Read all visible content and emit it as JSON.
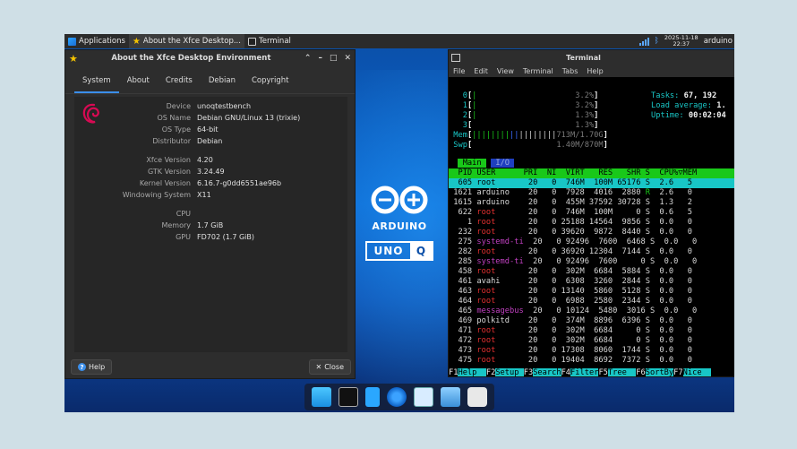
{
  "panel": {
    "apps_label": "Applications",
    "about_task": "About the Xfce Desktop...",
    "term_task": "Terminal",
    "date": "2025-11-18",
    "time": "22:37",
    "user": "arduino"
  },
  "about": {
    "title": "About the Xfce Desktop Environment",
    "tabs": [
      "System",
      "About",
      "Credits",
      "Debian",
      "Copyright"
    ],
    "rows": [
      {
        "k": "Device",
        "v": "unoqtestbench"
      },
      {
        "k": "OS Name",
        "v": "Debian GNU/Linux 13 (trixie)"
      },
      {
        "k": "OS Type",
        "v": "64-bit"
      },
      {
        "k": "Distributor",
        "v": "Debian"
      },
      {
        "k": "Xfce Version",
        "v": "4.20"
      },
      {
        "k": "GTK Version",
        "v": "3.24.49"
      },
      {
        "k": "Kernel Version",
        "v": "6.16.7-g0dd6551ae96b"
      },
      {
        "k": "Windowing System",
        "v": "X11"
      },
      {
        "k": "CPU",
        "v": ""
      },
      {
        "k": "Memory",
        "v": "1.7 GiB"
      },
      {
        "k": "GPU",
        "v": "FD702 (1.7 GiB)"
      }
    ],
    "help_label": "Help",
    "close_label": "Close"
  },
  "brand": {
    "word": "ARDUINO",
    "uno": "UNO",
    "q": "Q"
  },
  "terminal": {
    "title": "Terminal",
    "menu": [
      "File",
      "Edit",
      "View",
      "Terminal",
      "Tabs",
      "Help"
    ],
    "cpus": [
      {
        "n": "0",
        "pct": "3.2%"
      },
      {
        "n": "1",
        "pct": "3.2%"
      },
      {
        "n": "2",
        "pct": "1.3%"
      },
      {
        "n": "3",
        "pct": "1.3%"
      }
    ],
    "tasks_label": "Tasks:",
    "tasks_value": "67, 192",
    "load_label": "Load average:",
    "load_value": "1.",
    "uptime_label": "Uptime:",
    "uptime_value": "00:02:04",
    "mem_label": "Mem",
    "mem_value": "713M/1.70G",
    "swp_label": "Swp",
    "swp_value": "1.40M/870M",
    "tab_main": "Main",
    "tab_io": "I/O",
    "header": "  PID USER      PRI  NI  VIRT   RES   SHR S  CPU%▽MEM",
    "processes": [
      {
        "pid": "605",
        "user": "root",
        "pri": "20",
        "ni": "0",
        "virt": "746M",
        "res": "100M",
        "shr": "65176",
        "s": "S",
        "cpu": "2.6",
        "mem": "5"
      },
      {
        "pid": "1621",
        "user": "arduino",
        "pri": "20",
        "ni": "0",
        "virt": "7928",
        "res": "4016",
        "shr": "2880",
        "s": "R",
        "cpu": "2.6",
        "mem": "0"
      },
      {
        "pid": "1615",
        "user": "arduino",
        "pri": "20",
        "ni": "0",
        "virt": "455M",
        "res": "37592",
        "shr": "30728",
        "s": "S",
        "cpu": "1.3",
        "mem": "2"
      },
      {
        "pid": "622",
        "user": "root",
        "pri": "20",
        "ni": "0",
        "virt": "746M",
        "res": "100M",
        "shr": "0",
        "s": "S",
        "cpu": "0.6",
        "mem": "5"
      },
      {
        "pid": "1",
        "user": "root",
        "pri": "20",
        "ni": "0",
        "virt": "25188",
        "res": "14564",
        "shr": "9856",
        "s": "S",
        "cpu": "0.0",
        "mem": "0"
      },
      {
        "pid": "232",
        "user": "root",
        "pri": "20",
        "ni": "0",
        "virt": "39620",
        "res": "9872",
        "shr": "8440",
        "s": "S",
        "cpu": "0.0",
        "mem": "0"
      },
      {
        "pid": "275",
        "user": "systemd-ti",
        "pri": "20",
        "ni": "0",
        "virt": "92496",
        "res": "7600",
        "shr": "6468",
        "s": "S",
        "cpu": "0.0",
        "mem": "0"
      },
      {
        "pid": "282",
        "user": "root",
        "pri": "20",
        "ni": "0",
        "virt": "36920",
        "res": "12304",
        "shr": "7144",
        "s": "S",
        "cpu": "0.0",
        "mem": "0"
      },
      {
        "pid": "285",
        "user": "systemd-ti",
        "pri": "20",
        "ni": "0",
        "virt": "92496",
        "res": "7600",
        "shr": "0",
        "s": "S",
        "cpu": "0.0",
        "mem": "0"
      },
      {
        "pid": "458",
        "user": "root",
        "pri": "20",
        "ni": "0",
        "virt": "302M",
        "res": "6684",
        "shr": "5884",
        "s": "S",
        "cpu": "0.0",
        "mem": "0"
      },
      {
        "pid": "461",
        "user": "avahi",
        "pri": "20",
        "ni": "0",
        "virt": "6308",
        "res": "3260",
        "shr": "2844",
        "s": "S",
        "cpu": "0.0",
        "mem": "0"
      },
      {
        "pid": "463",
        "user": "root",
        "pri": "20",
        "ni": "0",
        "virt": "13140",
        "res": "5860",
        "shr": "5128",
        "s": "S",
        "cpu": "0.0",
        "mem": "0"
      },
      {
        "pid": "464",
        "user": "root",
        "pri": "20",
        "ni": "0",
        "virt": "6988",
        "res": "2580",
        "shr": "2344",
        "s": "S",
        "cpu": "0.0",
        "mem": "0"
      },
      {
        "pid": "465",
        "user": "messagebus",
        "pri": "20",
        "ni": "0",
        "virt": "10124",
        "res": "5480",
        "shr": "3016",
        "s": "S",
        "cpu": "0.0",
        "mem": "0"
      },
      {
        "pid": "469",
        "user": "polkitd",
        "pri": "20",
        "ni": "0",
        "virt": "374M",
        "res": "8896",
        "shr": "6396",
        "s": "S",
        "cpu": "0.0",
        "mem": "0"
      },
      {
        "pid": "471",
        "user": "root",
        "pri": "20",
        "ni": "0",
        "virt": "302M",
        "res": "6684",
        "shr": "0",
        "s": "S",
        "cpu": "0.0",
        "mem": "0"
      },
      {
        "pid": "472",
        "user": "root",
        "pri": "20",
        "ni": "0",
        "virt": "302M",
        "res": "6684",
        "shr": "0",
        "s": "S",
        "cpu": "0.0",
        "mem": "0"
      },
      {
        "pid": "473",
        "user": "root",
        "pri": "20",
        "ni": "0",
        "virt": "17308",
        "res": "8060",
        "shr": "1744",
        "s": "S",
        "cpu": "0.0",
        "mem": "0"
      },
      {
        "pid": "475",
        "user": "root",
        "pri": "20",
        "ni": "0",
        "virt": "19404",
        "res": "8692",
        "shr": "7372",
        "s": "S",
        "cpu": "0.0",
        "mem": "0"
      }
    ],
    "fkeys": [
      {
        "k": "F1",
        "l": "Help"
      },
      {
        "k": "F2",
        "l": "Setup"
      },
      {
        "k": "F3",
        "l": "Search"
      },
      {
        "k": "F4",
        "l": "Filter"
      },
      {
        "k": "F5",
        "l": "Tree"
      },
      {
        "k": "F6",
        "l": "SortBy"
      },
      {
        "k": "F7",
        "l": "Nice"
      }
    ]
  },
  "colors": {
    "accent": "#3b8eea",
    "htop_green": "#19c819",
    "htop_cyan": "#18c6c6"
  }
}
